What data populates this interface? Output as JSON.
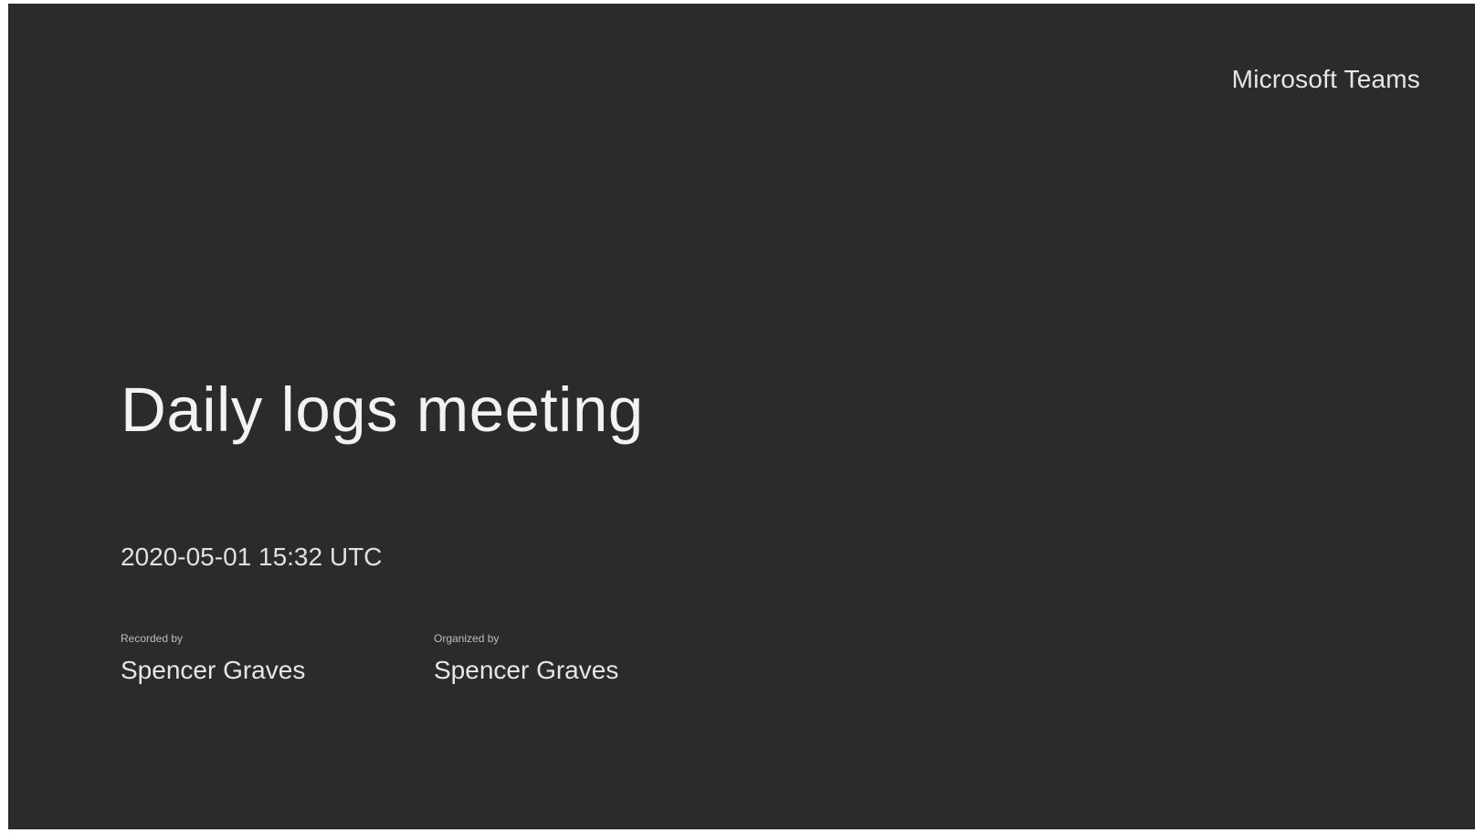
{
  "slide": {
    "brand": "Microsoft Teams",
    "title": "Daily logs meeting",
    "datetime": "2020-05-01 15:32 UTC",
    "recorded_by": {
      "label": "Recorded by",
      "name": "Spencer Graves"
    },
    "organized_by": {
      "label": "Organized by",
      "name": "Spencer Graves"
    }
  },
  "colors": {
    "background": "#2b2b2b",
    "text": "#f2f2f2"
  }
}
